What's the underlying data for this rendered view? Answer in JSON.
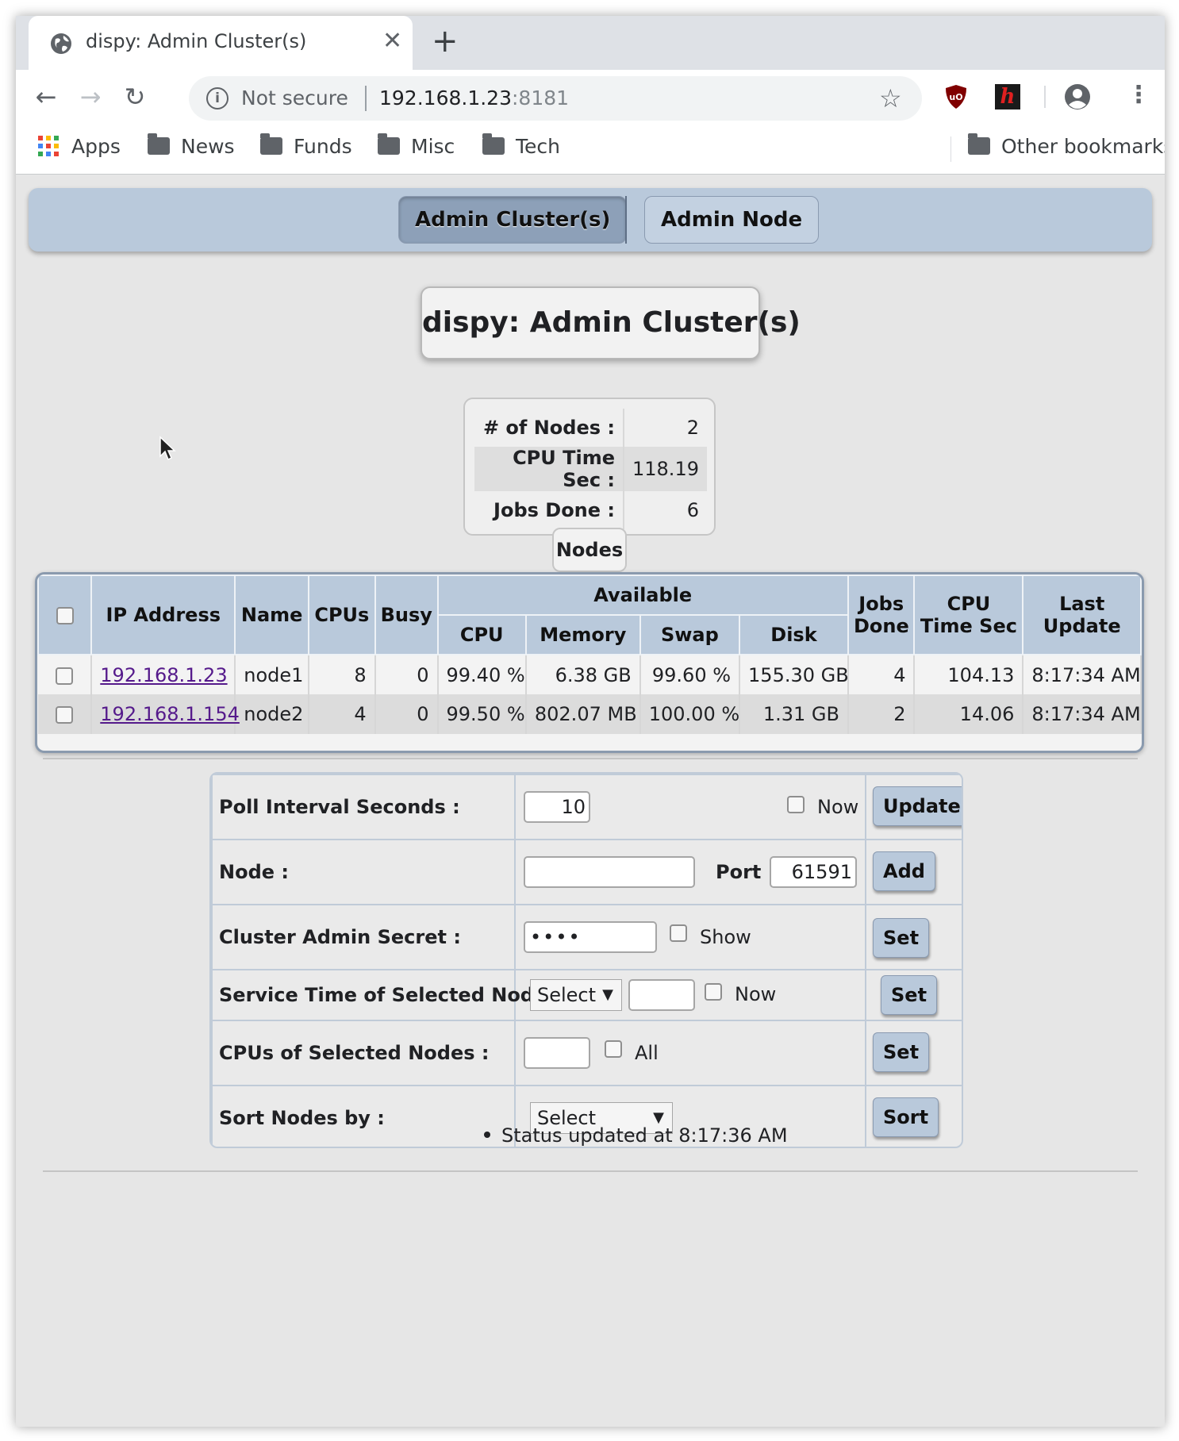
{
  "browser": {
    "tab_title": "dispy: Admin Cluster(s)",
    "security_label": "Not secure",
    "url_host": "192.168.1.23",
    "url_port": ":8181",
    "bookmarks": [
      "Apps",
      "News",
      "Funds",
      "Misc",
      "Tech"
    ],
    "other_bookmarks": "Other bookmarks"
  },
  "nav": {
    "admin_clusters": "Admin Cluster(s)",
    "admin_node": "Admin Node"
  },
  "page_title": "dispy: Admin Cluster(s)",
  "summary": {
    "rows": [
      {
        "label": "# of Nodes :",
        "value": "2"
      },
      {
        "label": "CPU Time Sec :",
        "value": "118.19"
      },
      {
        "label": "Jobs Done :",
        "value": "6"
      }
    ]
  },
  "nodes_label": "Nodes",
  "node_table": {
    "headers": {
      "ip": "IP Address",
      "name": "Name",
      "cpus": "CPUs",
      "busy": "Busy",
      "available": "Available",
      "cpu": "CPU",
      "memory": "Memory",
      "swap": "Swap",
      "disk": "Disk",
      "jobs_done": "Jobs Done",
      "cpu_time": "CPU Time Sec",
      "last_update": "Last Update"
    },
    "rows": [
      {
        "ip": "192.168.1.23",
        "name": "node1",
        "cpus": "8",
        "busy": "0",
        "cpu": "99.40 %",
        "memory": "6.38 GB",
        "swap": "99.60 %",
        "disk": "155.30 GB",
        "jobs_done": "4",
        "cpu_time": "104.13",
        "last_update": "8:17:34 AM"
      },
      {
        "ip": "192.168.1.154",
        "name": "node2",
        "cpus": "4",
        "busy": "0",
        "cpu": "99.50 %",
        "memory": "802.07 MB",
        "swap": "100.00 %",
        "disk": "1.31 GB",
        "jobs_done": "2",
        "cpu_time": "14.06",
        "last_update": "8:17:34 AM"
      }
    ]
  },
  "controls": {
    "poll": {
      "label": "Poll Interval Seconds :",
      "value": "10",
      "now": "Now",
      "button": "Update"
    },
    "node": {
      "label": "Node :",
      "value": "",
      "port_label": "Port :",
      "port_value": "61591",
      "button": "Add"
    },
    "secret": {
      "label": "Cluster Admin Secret :",
      "value": "••••",
      "show": "Show",
      "button": "Set"
    },
    "service": {
      "label": "Service Time of Selected Nodes :",
      "select": "Select",
      "value": "",
      "now": "Now",
      "button": "Set"
    },
    "cpus": {
      "label": "CPUs of Selected Nodes :",
      "value": "",
      "all": "All",
      "button": "Set"
    },
    "sort": {
      "label": "Sort Nodes by :",
      "select": "Select",
      "button": "Sort"
    }
  },
  "status": "Status updated at 8:17:36 AM"
}
